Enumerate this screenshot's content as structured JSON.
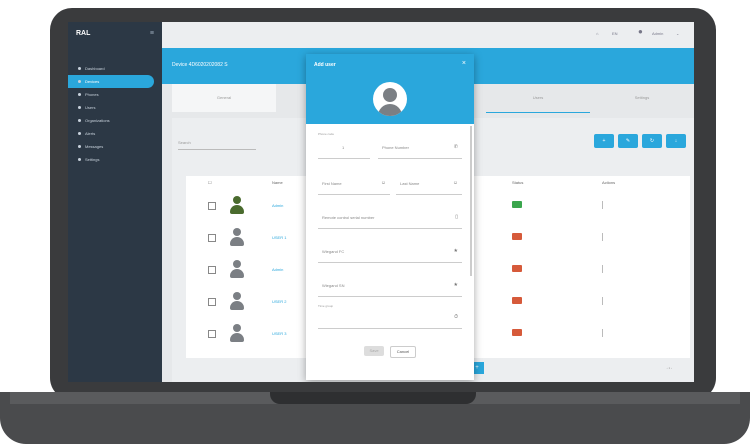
{
  "app": {
    "logo": "RAL",
    "menu_icon": "hamburger-icon"
  },
  "sidebar": {
    "items": [
      {
        "label": "Dashboard"
      },
      {
        "label": "Devices"
      },
      {
        "label": "Phones"
      },
      {
        "label": "Users"
      },
      {
        "label": "Organizations"
      },
      {
        "label": "Alerts"
      },
      {
        "label": "Messages"
      },
      {
        "label": "Settings"
      }
    ]
  },
  "topbar": {
    "lang": "EN",
    "user": "Admin"
  },
  "banner": {
    "device_title": "Device 4D6020202082 S"
  },
  "tabs": [
    {
      "label": "General"
    },
    {
      "label": ""
    },
    {
      "label": ""
    },
    {
      "label": "Users"
    },
    {
      "label": "Settings"
    }
  ],
  "content": {
    "search_label": "Search",
    "table": {
      "headers": [
        "",
        "Name",
        "Status",
        "Actions"
      ],
      "rows": [
        {
          "name": "Admin",
          "status_color": "#3aa64d"
        },
        {
          "name": "USER 1",
          "status_color": "#d65a3a"
        },
        {
          "name": "Admin",
          "status_color": "#d65a3a"
        },
        {
          "name": "USER 2",
          "status_color": "#d65a3a"
        },
        {
          "name": "USER 3",
          "status_color": "#d65a3a"
        }
      ]
    }
  },
  "modal": {
    "title": "Add user",
    "fields": {
      "phone_prefix_label": "Phone code",
      "phone_prefix_value": "1",
      "phone_number": "Phone Number",
      "first_name": "First Name",
      "last_name": "Last Name",
      "remote_control": "Remote control serial number",
      "wiegand_fc": "Wiegand FC",
      "wiegand_sn": "Wiegand SN",
      "time_group": "Time group"
    },
    "save_label": "Save",
    "cancel_label": "Cancel"
  },
  "colors": {
    "accent": "#2aa7dc",
    "sidebar": "#2c3845"
  }
}
